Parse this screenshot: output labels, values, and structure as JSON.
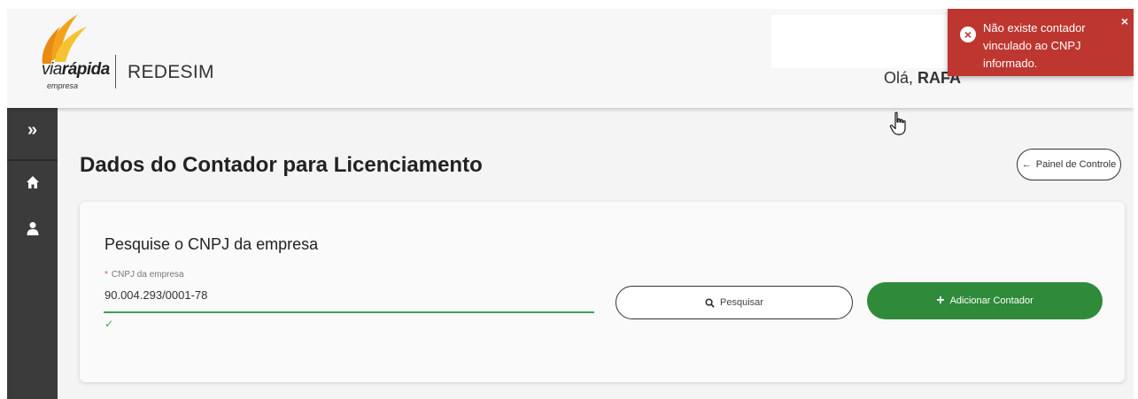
{
  "header": {
    "logo": {
      "brand_prefix": "via",
      "brand_suffix": "rápida",
      "brand_sub": "empresa",
      "product": "REDESIM"
    },
    "greeting_prefix": "Olá,",
    "greeting_name": "RAFA"
  },
  "toast": {
    "message": "Não existe contador vinculado ao CNPJ informado.",
    "close_symbol": "×",
    "icon": "close-circle-icon",
    "color": "#bd362f"
  },
  "sidebar": {
    "toggle_symbol": "»",
    "items": [
      {
        "icon": "home-icon"
      },
      {
        "icon": "user-icon"
      }
    ],
    "color": "#3b3b3b"
  },
  "page": {
    "title": "Dados do Contador para Licenciamento",
    "back_button": {
      "arrow": "←",
      "label": "Painel de Controle"
    }
  },
  "search_card": {
    "title": "Pesquise o CNPJ da empresa",
    "field": {
      "required_mark": "*",
      "label": "CNPJ da empresa",
      "value": "90.004.293/0001-78",
      "valid_mark": "✓"
    },
    "search_button": {
      "label": "Pesquisar",
      "icon": "search-icon"
    },
    "add_button": {
      "label": "Adicionar Contador",
      "plus": "+",
      "color": "#2f8a3a"
    }
  },
  "accent_color": "#3ca156"
}
